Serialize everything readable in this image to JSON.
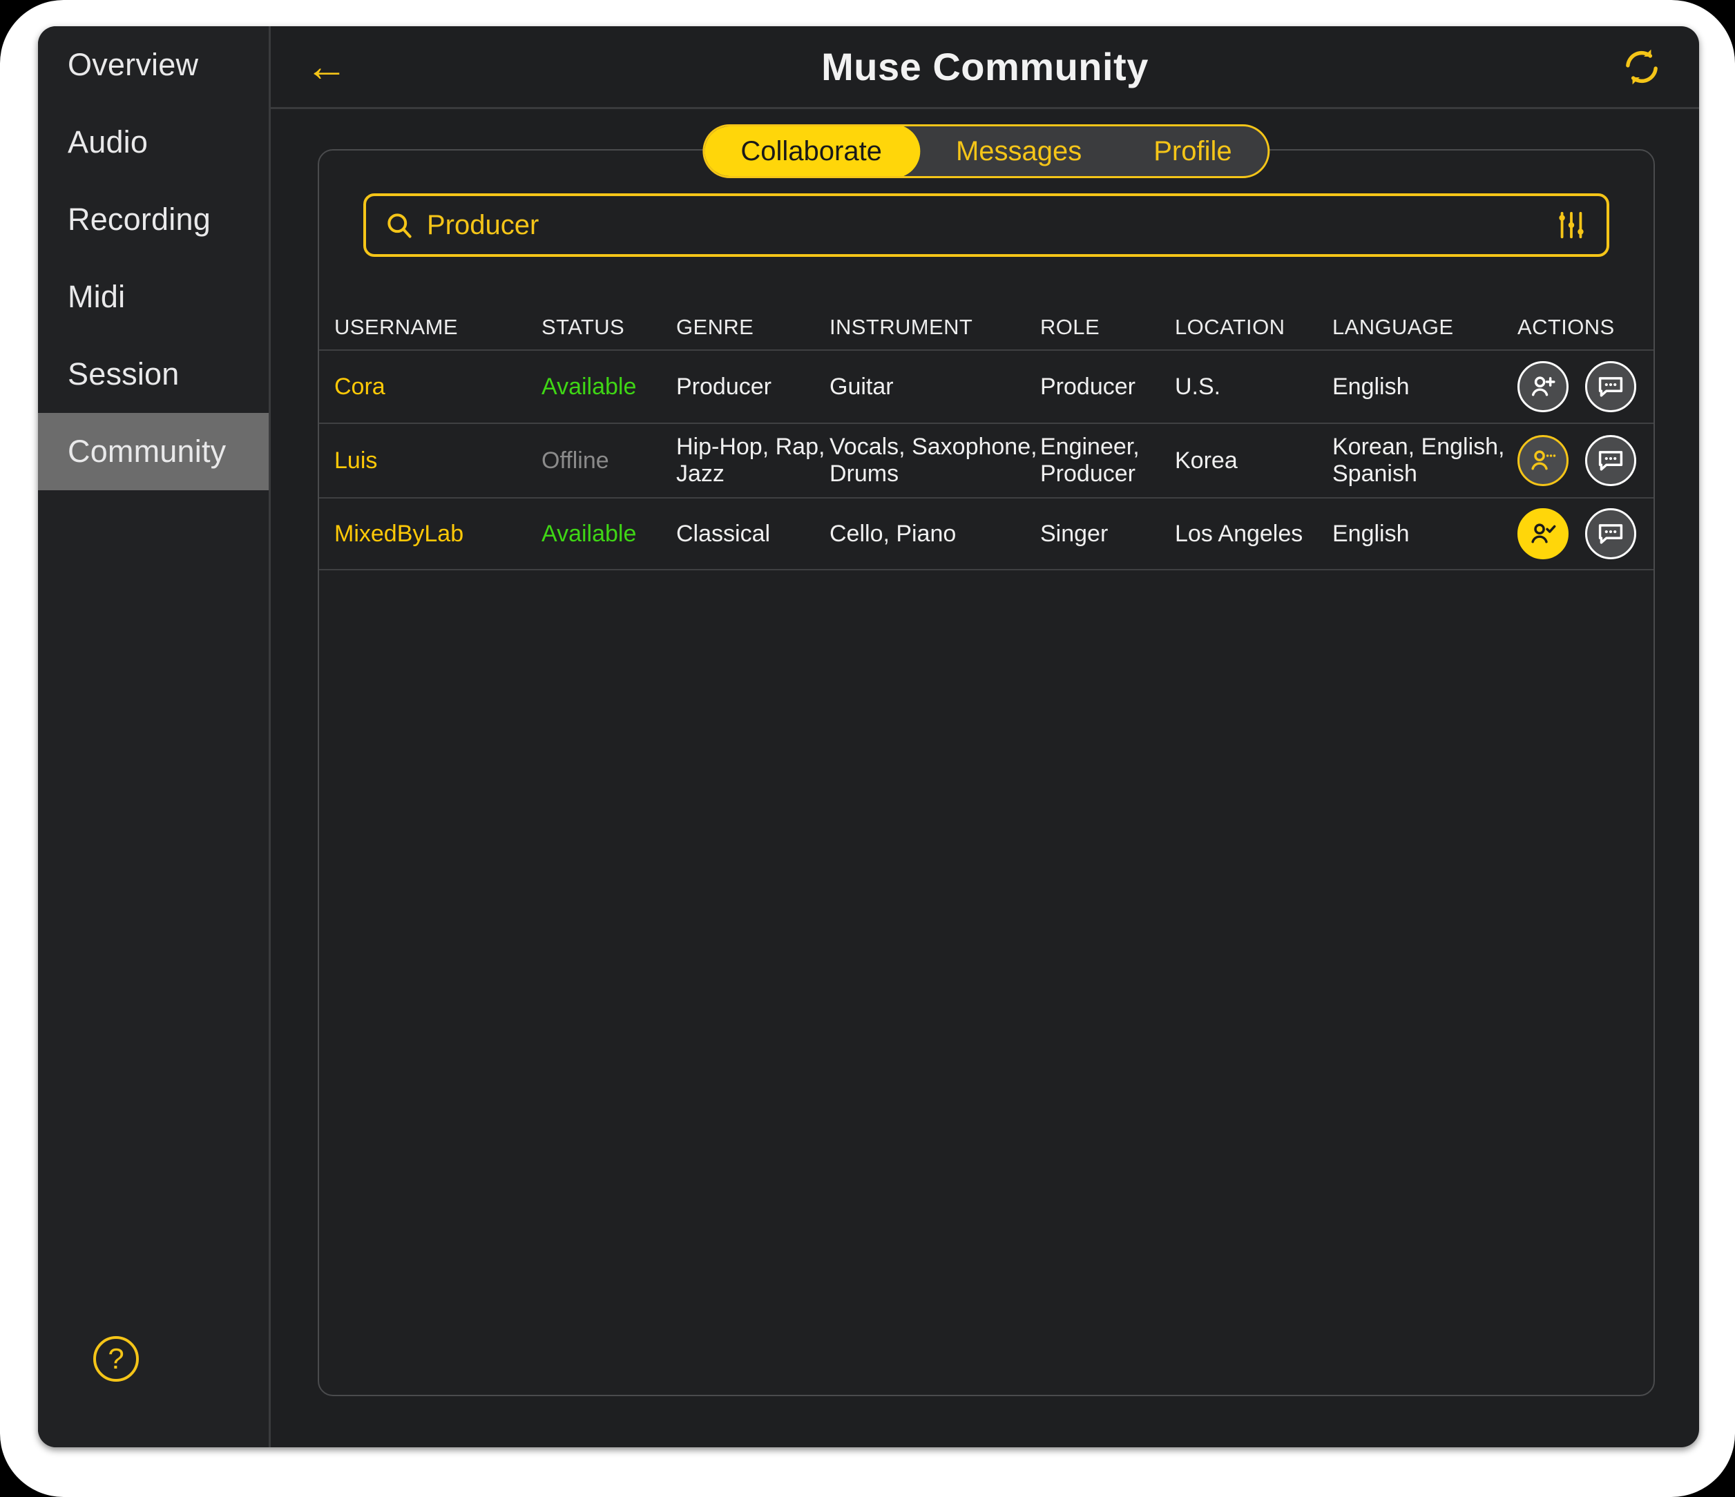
{
  "colors": {
    "accent": "#ffd60a",
    "accent_text": "#f5c518",
    "username": "#ffc907",
    "available": "#3fd615",
    "offline": "#8b8b8b",
    "window_bg": "#1e1f21",
    "sidebar_bg": "#212224",
    "sidebar_active": "#6c6c6c"
  },
  "sidebar": {
    "items": [
      {
        "label": "Overview",
        "active": false
      },
      {
        "label": "Audio",
        "active": false
      },
      {
        "label": "Recording",
        "active": false
      },
      {
        "label": "Midi",
        "active": false
      },
      {
        "label": "Session",
        "active": false
      },
      {
        "label": "Community",
        "active": true
      }
    ],
    "help_label": "?"
  },
  "titlebar": {
    "back_label": "←",
    "title": "Muse Community",
    "refresh_icon": "refresh-icon"
  },
  "tabs": [
    {
      "label": "Collaborate",
      "active": true
    },
    {
      "label": "Messages",
      "active": false
    },
    {
      "label": "Profile",
      "active": false
    }
  ],
  "search": {
    "value": "Producer",
    "placeholder": "Search",
    "search_icon": "search-icon",
    "filter_icon": "filter-sliders-icon"
  },
  "table": {
    "columns": [
      "USERNAME",
      "STATUS",
      "GENRE",
      "INSTRUMENT",
      "ROLE",
      "LOCATION",
      "LANGUAGE",
      "ACTIONS"
    ],
    "rows": [
      {
        "username": "Cora",
        "status": "Available",
        "status_kind": "available",
        "genre": "Producer",
        "instrument": "Guitar",
        "role": "Producer",
        "location": "U.S.",
        "language": "English",
        "connect_icon": "person-add-icon",
        "connect_state": "add",
        "message_icon": "message-bubble-icon"
      },
      {
        "username": "Luis",
        "status": "Offline",
        "status_kind": "offline",
        "genre": "Hip-Hop, Rap, Jazz",
        "instrument": "Vocals, Saxophone, Drums",
        "role": "Engineer, Producer",
        "location": "Korea",
        "language": "Korean, English, Spanish",
        "connect_icon": "person-pending-icon",
        "connect_state": "pending",
        "message_icon": "message-bubble-icon"
      },
      {
        "username": "MixedByLab",
        "status": "Available",
        "status_kind": "available",
        "genre": "Classical",
        "instrument": "Cello, Piano",
        "role": "Singer",
        "location": "Los Angeles",
        "language": "English",
        "connect_icon": "person-check-icon",
        "connect_state": "connected",
        "message_icon": "message-bubble-icon"
      }
    ]
  }
}
